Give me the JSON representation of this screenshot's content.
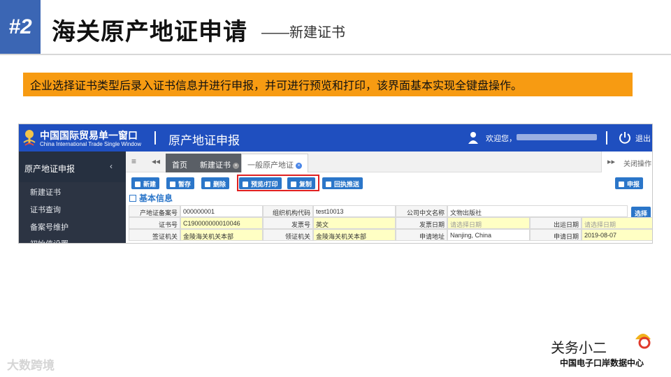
{
  "slide": {
    "number": "#2",
    "title": "海关原产地证申请",
    "subtitle": "——新建证书",
    "banner": "企业选择证书类型后录入证书信息并进行申报，并可进行预览和打印，该界面基本实现全键盘操作。"
  },
  "app": {
    "logo_cn": "中国国际贸易单一窗口",
    "logo_en": "China International Trade Single Window",
    "title": "原产地证申报",
    "welcome": "欢迎您，",
    "logout": "退出",
    "sidebar": {
      "header": "原产地证申报",
      "items": [
        "新建证书",
        "证书查询",
        "备案号维护",
        "初始值设置"
      ]
    },
    "tabs": {
      "home": "首页",
      "new_cert": "新建证书",
      "general_origin": "一般原产地证",
      "close_ops": "关闭操作"
    },
    "toolbar": {
      "new": "新建",
      "save": "暂存",
      "delete": "删除",
      "preview_print": "预览/打印",
      "copy": "复制",
      "receipt": "回执推送",
      "declare": "申报"
    },
    "section_title": "基本信息",
    "select_button": "选择",
    "form": {
      "row1": {
        "l1": "产地证备案号",
        "v1": "000000001",
        "l2": "组织机构代码",
        "v2": "test10013",
        "l3": "公司中文名称",
        "v3": "文物出版社"
      },
      "row2": {
        "l1": "证书号",
        "v1": "C190000000010046",
        "l2": "发票号",
        "v2": "英文",
        "l3": "发票日期",
        "v3": "请选择日期",
        "l4": "出运日期",
        "v4": "请选择日期"
      },
      "row3": {
        "l1": "签证机关",
        "v1": "金陵海关机关本部",
        "l2": "领证机关",
        "v2": "金陵海关机关本部",
        "l3": "申请地址",
        "v3": "Nanjing, China",
        "l4": "申请日期",
        "v4": "2019-08-07"
      }
    }
  },
  "watermark_left": "大数跨境",
  "brand": {
    "top": "关务小二",
    "bottom": "中国电子口岸数据中心"
  },
  "colors": {
    "accent_blue": "#3b66b4",
    "app_header": "#1f4fbf",
    "banner_orange": "#f79b12",
    "button_blue": "#2b76c9",
    "highlight_red": "#e02020"
  }
}
